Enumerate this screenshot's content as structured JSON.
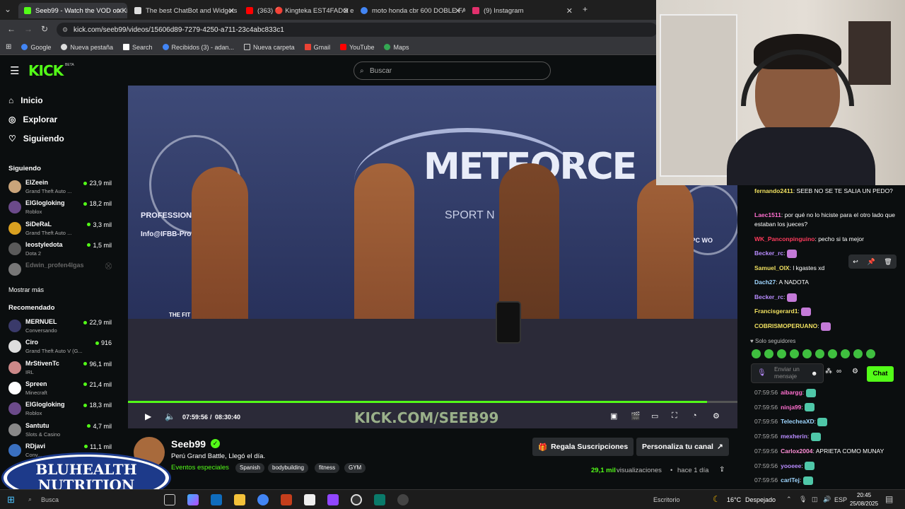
{
  "browser": {
    "tabs": [
      {
        "title": "Seeb99 - Watch the VOD on Ki",
        "active": true
      },
      {
        "title": "The best ChatBot and Widgets"
      },
      {
        "title": "(363) 🔴 Kingteka EST4FADO e"
      },
      {
        "title": "moto honda cbr 600 DOBLE FA"
      },
      {
        "title": "(9) Instagram"
      }
    ],
    "url": "kick.com/seeb99/videos/15606d89-7279-4250-a711-23c4abc833c1",
    "bookmarks": [
      "Google",
      "Nueva pestaña",
      "Search",
      "Recibidos (3) - adan...",
      "Nueva carpeta",
      "Gmail",
      "YouTube",
      "Maps"
    ]
  },
  "kick": {
    "logo": "KICK",
    "beta": "BETA",
    "search_placeholder": "Buscar"
  },
  "sidebar": {
    "nav": [
      {
        "label": "Inicio"
      },
      {
        "label": "Explorar"
      },
      {
        "label": "Siguiendo"
      }
    ],
    "following_title": "Siguiendo",
    "following": [
      {
        "name": "ElZeein",
        "game": "Grand Theft Auto ...",
        "viewers": "23,9 mil",
        "color": "#c9a47a"
      },
      {
        "name": "ElGlogloking",
        "game": "Roblox",
        "viewers": "18,2 mil",
        "color": "#6b4a8a"
      },
      {
        "name": "SiDeRaL",
        "game": "Grand Theft Auto ...",
        "viewers": "3,3 mil",
        "color": "#d9a020"
      },
      {
        "name": "leostyledota",
        "game": "Dota 2",
        "viewers": "1,5 mil",
        "color": "#5a5a5a"
      },
      {
        "name": "Edwin_profen4lgas",
        "game": "",
        "viewers": "",
        "color": "#777"
      }
    ],
    "show_more": "Mostrar más",
    "recommended_title": "Recomendado",
    "recommended": [
      {
        "name": "MERNUEL",
        "game": "Conversando",
        "viewers": "22,9 mil",
        "color": "#3a3a6a"
      },
      {
        "name": "Ciro",
        "game": "Grand Theft Auto V (G...",
        "viewers": "916",
        "color": "#ddd"
      },
      {
        "name": "MrStivenTc",
        "game": "IRL",
        "viewers": "96,1 mil",
        "color": "#c88"
      },
      {
        "name": "Spreen",
        "game": "Minecraft",
        "viewers": "21,4 mil",
        "color": "#fff"
      },
      {
        "name": "ElGlogloking",
        "game": "Roblox",
        "viewers": "18,3 mil",
        "color": "#6b4a8a"
      },
      {
        "name": "Santutu",
        "game": "Slots & Casino",
        "viewers": "4,7 mil",
        "color": "#888"
      },
      {
        "name": "RDjavi",
        "game": "Conv...",
        "viewers": "11,1 mil",
        "color": "#3a70c0"
      }
    ]
  },
  "video": {
    "watermark": "KICK.COM/SEEB99",
    "time_current": "07:59:56",
    "time_total": "08:30:40",
    "progress": 0.95,
    "banner_1": "METFORCE",
    "banner_2": "SPORT N",
    "banner_3": "PROFESSIONAL LEAGUE",
    "banner_4": "Info@IFBB-Pro...",
    "banner_5": "THE FIT MONS",
    "banner_6": "NPC WO"
  },
  "info": {
    "streamer": "Seeb99",
    "title": "Perú Grand Battle, Llegó el día.",
    "category": "Eventos especiales",
    "tags": [
      "Spanish",
      "bodybuilding",
      "fitness",
      "GYM"
    ],
    "gift_button": "Regala Suscripciones",
    "customize_button": "Personaliza tu canal",
    "views_count": "29,1 mil",
    "views_label": "visualizaciones",
    "age": "hace 1 día"
  },
  "chat": {
    "messages": [
      {
        "user": "fernando2411",
        "color": "#f0e060",
        "text": "SEEB NO SE TE SALIA UN PEDO?"
      },
      {
        "user": "Laec1511",
        "color": "#ff6fcf",
        "text": "por qué no lo hiciste para el otro lado que estaban los jueces?"
      },
      {
        "user": "WK_Panconpinguino",
        "color": "#ff3b5c",
        "text": "pecho si ta mejor"
      },
      {
        "user": "Becker_rc",
        "color": "#b98cff",
        "text": ""
      },
      {
        "user": "Samuel_OIX",
        "color": "#f0e060",
        "text": "l kgastes xd"
      },
      {
        "user": "Dach27",
        "color": "#9fd6ff",
        "text": "A NADOTA"
      },
      {
        "user": "Becker_rc",
        "color": "#b98cff",
        "text": ""
      },
      {
        "user": "Francisgerard1",
        "color": "#f0e060",
        "text": ""
      },
      {
        "user": "COBRISMOPERUANO",
        "color": "#f0e060",
        "text": ""
      }
    ],
    "followers_only": "Solo seguidores",
    "input_placeholder": "Enviar un mensaje",
    "send_button": "Chat",
    "lower_messages": [
      {
        "time": "07:59:56",
        "user": "aibargg",
        "color": "#ff6fcf",
        "text": ""
      },
      {
        "time": "07:59:56",
        "user": "ninja99",
        "color": "#ff6fcf",
        "text": ""
      },
      {
        "time": "07:59:56",
        "user": "TelecheaXD",
        "color": "#9fd6ff",
        "text": ""
      },
      {
        "time": "07:59:56",
        "user": "mexherin",
        "color": "#b98cff",
        "text": ""
      },
      {
        "time": "07:59:56",
        "user": "Carlox2004",
        "color": "#ff8fd6",
        "text": "APRIETA COMO MUNAY"
      },
      {
        "time": "07:59:56",
        "user": "yooeee",
        "color": "#b98cff",
        "text": ""
      },
      {
        "time": "07:59:56",
        "user": "carlTej",
        "color": "#9fd6ff",
        "text": ""
      }
    ]
  },
  "overlay": {
    "logo_line1": "BLUHEALTH",
    "logo_line2": "NUTRITION"
  },
  "taskbar": {
    "search": "Busca",
    "desktop": "Escritorio",
    "weather_temp": "16°C",
    "weather_desc": "Despejado",
    "lang": "ESP",
    "time": "20:45",
    "date": "25/08/2025"
  }
}
